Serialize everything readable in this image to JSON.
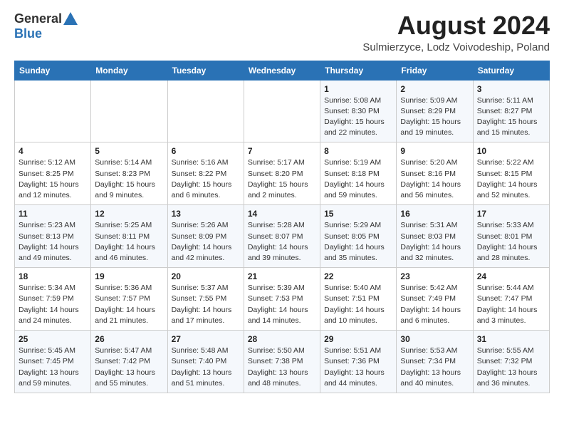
{
  "header": {
    "logo_general": "General",
    "logo_blue": "Blue",
    "month_title": "August 2024",
    "location": "Sulmierzyce, Lodz Voivodeship, Poland"
  },
  "calendar": {
    "weekdays": [
      "Sunday",
      "Monday",
      "Tuesday",
      "Wednesday",
      "Thursday",
      "Friday",
      "Saturday"
    ],
    "weeks": [
      [
        {
          "day": "",
          "info": ""
        },
        {
          "day": "",
          "info": ""
        },
        {
          "day": "",
          "info": ""
        },
        {
          "day": "",
          "info": ""
        },
        {
          "day": "1",
          "info": "Sunrise: 5:08 AM\nSunset: 8:30 PM\nDaylight: 15 hours\nand 22 minutes."
        },
        {
          "day": "2",
          "info": "Sunrise: 5:09 AM\nSunset: 8:29 PM\nDaylight: 15 hours\nand 19 minutes."
        },
        {
          "day": "3",
          "info": "Sunrise: 5:11 AM\nSunset: 8:27 PM\nDaylight: 15 hours\nand 15 minutes."
        }
      ],
      [
        {
          "day": "4",
          "info": "Sunrise: 5:12 AM\nSunset: 8:25 PM\nDaylight: 15 hours\nand 12 minutes."
        },
        {
          "day": "5",
          "info": "Sunrise: 5:14 AM\nSunset: 8:23 PM\nDaylight: 15 hours\nand 9 minutes."
        },
        {
          "day": "6",
          "info": "Sunrise: 5:16 AM\nSunset: 8:22 PM\nDaylight: 15 hours\nand 6 minutes."
        },
        {
          "day": "7",
          "info": "Sunrise: 5:17 AM\nSunset: 8:20 PM\nDaylight: 15 hours\nand 2 minutes."
        },
        {
          "day": "8",
          "info": "Sunrise: 5:19 AM\nSunset: 8:18 PM\nDaylight: 14 hours\nand 59 minutes."
        },
        {
          "day": "9",
          "info": "Sunrise: 5:20 AM\nSunset: 8:16 PM\nDaylight: 14 hours\nand 56 minutes."
        },
        {
          "day": "10",
          "info": "Sunrise: 5:22 AM\nSunset: 8:15 PM\nDaylight: 14 hours\nand 52 minutes."
        }
      ],
      [
        {
          "day": "11",
          "info": "Sunrise: 5:23 AM\nSunset: 8:13 PM\nDaylight: 14 hours\nand 49 minutes."
        },
        {
          "day": "12",
          "info": "Sunrise: 5:25 AM\nSunset: 8:11 PM\nDaylight: 14 hours\nand 46 minutes."
        },
        {
          "day": "13",
          "info": "Sunrise: 5:26 AM\nSunset: 8:09 PM\nDaylight: 14 hours\nand 42 minutes."
        },
        {
          "day": "14",
          "info": "Sunrise: 5:28 AM\nSunset: 8:07 PM\nDaylight: 14 hours\nand 39 minutes."
        },
        {
          "day": "15",
          "info": "Sunrise: 5:29 AM\nSunset: 8:05 PM\nDaylight: 14 hours\nand 35 minutes."
        },
        {
          "day": "16",
          "info": "Sunrise: 5:31 AM\nSunset: 8:03 PM\nDaylight: 14 hours\nand 32 minutes."
        },
        {
          "day": "17",
          "info": "Sunrise: 5:33 AM\nSunset: 8:01 PM\nDaylight: 14 hours\nand 28 minutes."
        }
      ],
      [
        {
          "day": "18",
          "info": "Sunrise: 5:34 AM\nSunset: 7:59 PM\nDaylight: 14 hours\nand 24 minutes."
        },
        {
          "day": "19",
          "info": "Sunrise: 5:36 AM\nSunset: 7:57 PM\nDaylight: 14 hours\nand 21 minutes."
        },
        {
          "day": "20",
          "info": "Sunrise: 5:37 AM\nSunset: 7:55 PM\nDaylight: 14 hours\nand 17 minutes."
        },
        {
          "day": "21",
          "info": "Sunrise: 5:39 AM\nSunset: 7:53 PM\nDaylight: 14 hours\nand 14 minutes."
        },
        {
          "day": "22",
          "info": "Sunrise: 5:40 AM\nSunset: 7:51 PM\nDaylight: 14 hours\nand 10 minutes."
        },
        {
          "day": "23",
          "info": "Sunrise: 5:42 AM\nSunset: 7:49 PM\nDaylight: 14 hours\nand 6 minutes."
        },
        {
          "day": "24",
          "info": "Sunrise: 5:44 AM\nSunset: 7:47 PM\nDaylight: 14 hours\nand 3 minutes."
        }
      ],
      [
        {
          "day": "25",
          "info": "Sunrise: 5:45 AM\nSunset: 7:45 PM\nDaylight: 13 hours\nand 59 minutes."
        },
        {
          "day": "26",
          "info": "Sunrise: 5:47 AM\nSunset: 7:42 PM\nDaylight: 13 hours\nand 55 minutes."
        },
        {
          "day": "27",
          "info": "Sunrise: 5:48 AM\nSunset: 7:40 PM\nDaylight: 13 hours\nand 51 minutes."
        },
        {
          "day": "28",
          "info": "Sunrise: 5:50 AM\nSunset: 7:38 PM\nDaylight: 13 hours\nand 48 minutes."
        },
        {
          "day": "29",
          "info": "Sunrise: 5:51 AM\nSunset: 7:36 PM\nDaylight: 13 hours\nand 44 minutes."
        },
        {
          "day": "30",
          "info": "Sunrise: 5:53 AM\nSunset: 7:34 PM\nDaylight: 13 hours\nand 40 minutes."
        },
        {
          "day": "31",
          "info": "Sunrise: 5:55 AM\nSunset: 7:32 PM\nDaylight: 13 hours\nand 36 minutes."
        }
      ]
    ]
  }
}
